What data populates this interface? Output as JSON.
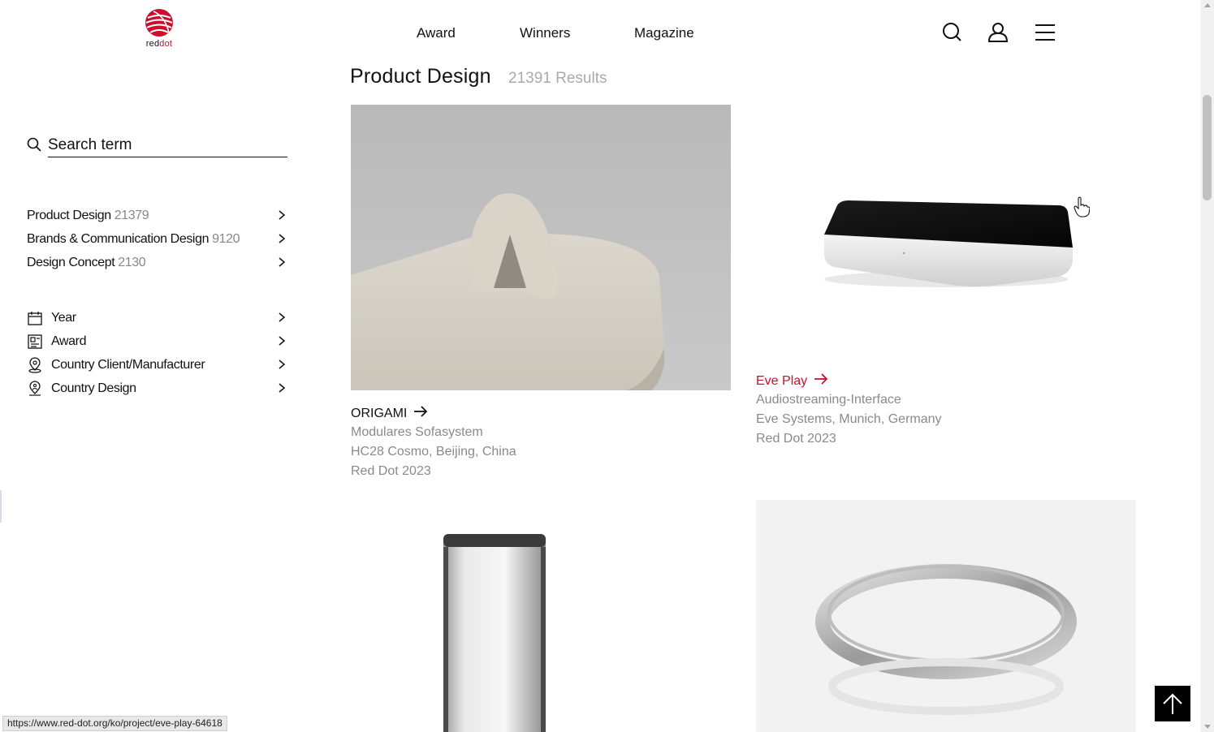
{
  "header": {
    "logo": {
      "text_red": "red",
      "text_dot": "dot"
    },
    "nav": [
      "Award",
      "Winners",
      "Magazine"
    ],
    "icons": [
      "search-icon",
      "user-icon",
      "menu-icon"
    ]
  },
  "sidebar": {
    "search_placeholder": "Search term",
    "categories": [
      {
        "label": "Product Design",
        "count": "21379"
      },
      {
        "label": "Brands & Communication Design",
        "count": "9120"
      },
      {
        "label": "Design Concept",
        "count": "2130"
      }
    ],
    "filters": [
      {
        "label": "Year",
        "icon": "calendar-icon"
      },
      {
        "label": "Award",
        "icon": "award-icon"
      },
      {
        "label": "Country Client/Manufacturer",
        "icon": "location-pin-icon"
      },
      {
        "label": "Country Design",
        "icon": "location-person-icon"
      }
    ]
  },
  "main": {
    "title": "Product Design",
    "results": "21391 Results",
    "cards": [
      {
        "name": "ORIGAMI",
        "description": "Modulares Sofasystem",
        "company": "HC28 Cosmo, Beijing, China",
        "award": "Red Dot 2023",
        "highlighted": false
      },
      {
        "name": "Eve Play",
        "description": "Audiostreaming-Interface",
        "company": "Eve Systems, Munich, Germany",
        "award": "Red Dot 2023",
        "highlighted": true
      }
    ]
  },
  "status_bar": {
    "url": "https://www.red-dot.org/ko/project/eve-play-64618"
  },
  "colors": {
    "accent": "#c8102e",
    "muted": "#8a8a8a",
    "text": "#111111"
  }
}
